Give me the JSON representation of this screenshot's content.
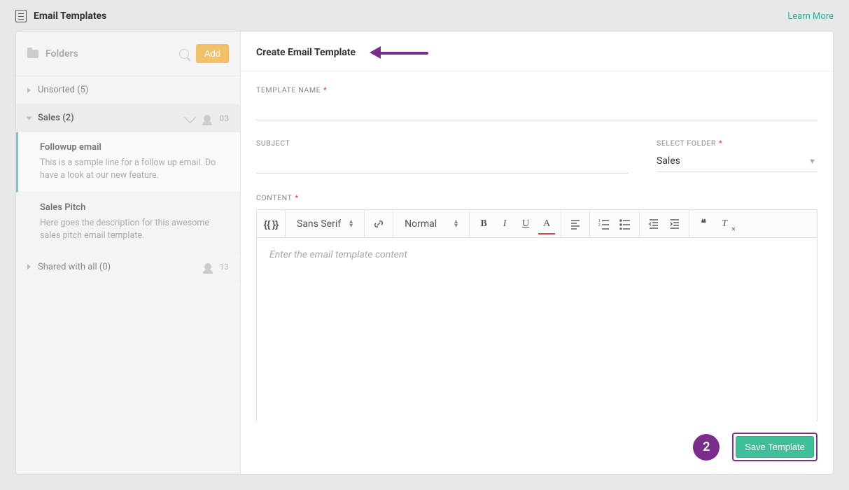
{
  "header": {
    "title": "Email Templates",
    "learn_more": "Learn More"
  },
  "sidebar": {
    "folders_label": "Folders",
    "add_label": "Add",
    "items": [
      {
        "label": "Unsorted (5)",
        "expanded": false
      },
      {
        "label": "Sales (2)",
        "expanded": true,
        "count": "03"
      },
      {
        "label": "Shared with all (0)",
        "expanded": false,
        "count": "13"
      }
    ],
    "templates": [
      {
        "name": "Followup email",
        "desc": "This is a sample line for a follow up email. Do have a look at our new feature."
      },
      {
        "name": "Sales Pitch",
        "desc": "Here goes the description for this awesome sales pitch email template."
      }
    ]
  },
  "form": {
    "heading": "Create Email Template",
    "template_name_label": "Template Name",
    "subject_label": "Subject",
    "select_folder_label": "Select Folder",
    "selected_folder": "Sales",
    "content_label": "Content",
    "editor_placeholder": "Enter the email template content",
    "font_family": "Sans Serif",
    "font_size": "Normal"
  },
  "footer": {
    "step": "2",
    "save_label": "Save Template"
  },
  "annotation": {
    "step_highlight": "2"
  }
}
